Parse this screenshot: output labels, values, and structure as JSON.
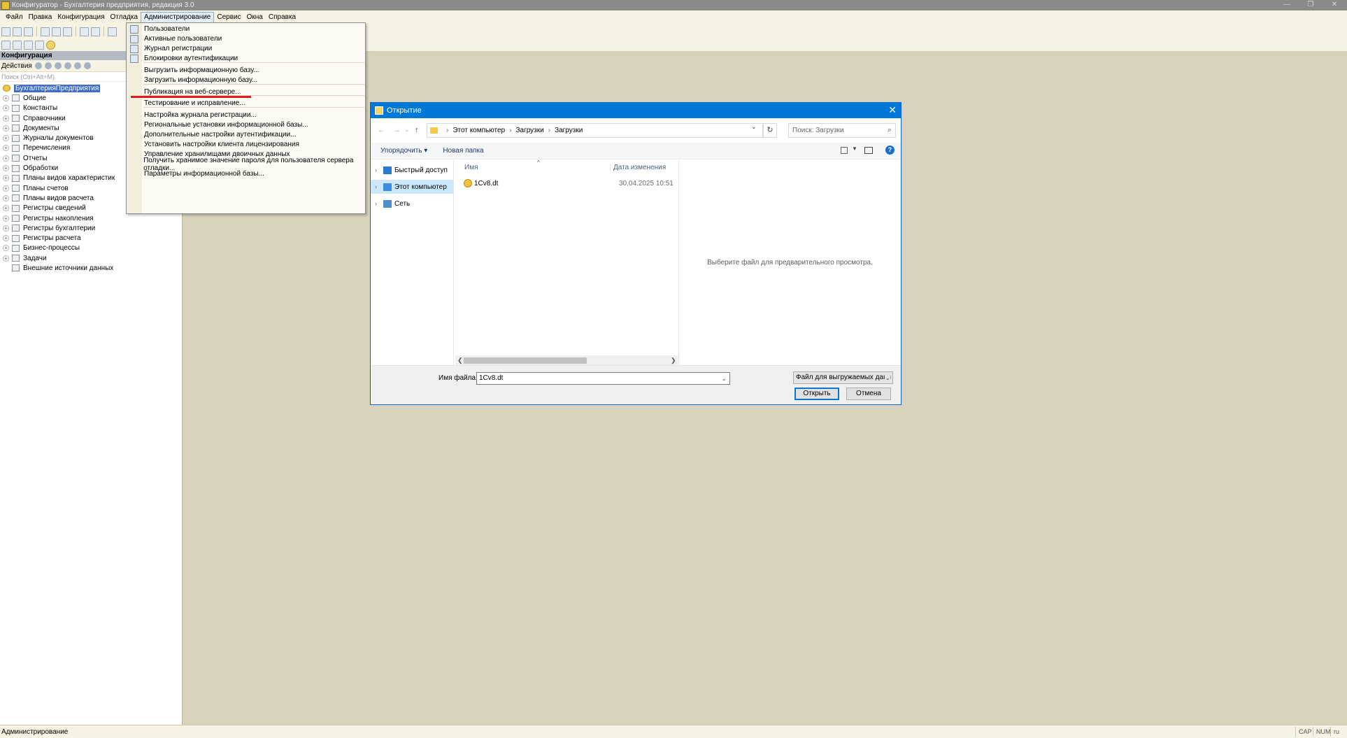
{
  "window": {
    "title": "Конфигуратор - Бухгалтерия предприятия, редакция 3.0"
  },
  "menubar": {
    "items": [
      "Файл",
      "Правка",
      "Конфигурация",
      "Отладка",
      "Администрирование",
      "Сервис",
      "Окна",
      "Справка"
    ],
    "active": "Администрирование"
  },
  "left_panel": {
    "header": "Конфигурация",
    "actions_label": "Действия",
    "search_placeholder": "Поиск (Ctrl+Alt+M)",
    "tree": [
      {
        "label": "БухгалтерияПредприятия",
        "root": true
      },
      {
        "label": "Общие"
      },
      {
        "label": "Константы"
      },
      {
        "label": "Справочники"
      },
      {
        "label": "Документы"
      },
      {
        "label": "Журналы документов"
      },
      {
        "label": "Перечисления"
      },
      {
        "label": "Отчеты"
      },
      {
        "label": "Обработки"
      },
      {
        "label": "Планы видов характеристик"
      },
      {
        "label": "Планы счетов"
      },
      {
        "label": "Планы видов расчета"
      },
      {
        "label": "Регистры сведений"
      },
      {
        "label": "Регистры накопления"
      },
      {
        "label": "Регистры бухгалтерии"
      },
      {
        "label": "Регистры расчета"
      },
      {
        "label": "Бизнес-процессы"
      },
      {
        "label": "Задачи"
      },
      {
        "label": "Внешние источники данных"
      }
    ]
  },
  "admin_menu": {
    "items": [
      {
        "label": "Пользователи",
        "icon": "users-icon"
      },
      {
        "label": "Активные пользователи",
        "icon": "active-users-icon"
      },
      {
        "label": "Журнал регистрации",
        "icon": "log-icon"
      },
      {
        "label": "Блокировки аутентификации",
        "icon": "lock-icon"
      },
      {
        "label": "Выгрузить информационную базу..."
      },
      {
        "label": "Загрузить информационную базу...",
        "highlighted": true
      },
      {
        "label": "Публикация на веб-сервере..."
      },
      {
        "label": "Тестирование и исправление..."
      },
      {
        "label": "Настройка журнала регистрации..."
      },
      {
        "label": "Региональные установки информационной базы..."
      },
      {
        "label": "Дополнительные настройки аутентификации..."
      },
      {
        "label": "Установить настройки клиента лицензирования"
      },
      {
        "label": "Управление хранилищами двоичных данных"
      },
      {
        "label": "Получить хранимое значение пароля для пользователя сервера отладки..."
      },
      {
        "label": "Параметры информационной базы..."
      }
    ]
  },
  "open_dialog": {
    "title": "Открытие",
    "breadcrumb": [
      "Этот компьютер",
      "Загрузки",
      "Загрузки"
    ],
    "search_placeholder": "Поиск: Загрузки",
    "organize_label": "Упорядочить",
    "new_folder_label": "Новая папка",
    "nav": [
      {
        "label": "Быстрый доступ",
        "icon": "star-icon"
      },
      {
        "label": "Этот компьютер",
        "icon": "computer-icon",
        "selected": true
      },
      {
        "label": "Сеть",
        "icon": "network-icon"
      }
    ],
    "columns": {
      "name": "Имя",
      "date": "Дата изменения"
    },
    "files": [
      {
        "name": "1Cv8.dt",
        "date": "30.04.2025 10:51"
      }
    ],
    "preview_text": "Выберите файл для предварительного просмотра.",
    "filename_label": "Имя файла:",
    "filename_value": "1Cv8.dt",
    "filter_value": "Файл для выгружаемых данн",
    "open_label": "Открыть",
    "cancel_label": "Отмена"
  },
  "statusbar": {
    "text": "Администрирование",
    "indicators": [
      "CAP",
      "NUM",
      "ru ▾"
    ]
  },
  "colors": {
    "titlebar_bg": "#8a8a8a",
    "menubar_bg": "#f6f3e2",
    "workspace_bg": "#d8d2bd",
    "dialog_title_bg": "#0078d7",
    "highlight_underline": "#e01b1b"
  }
}
